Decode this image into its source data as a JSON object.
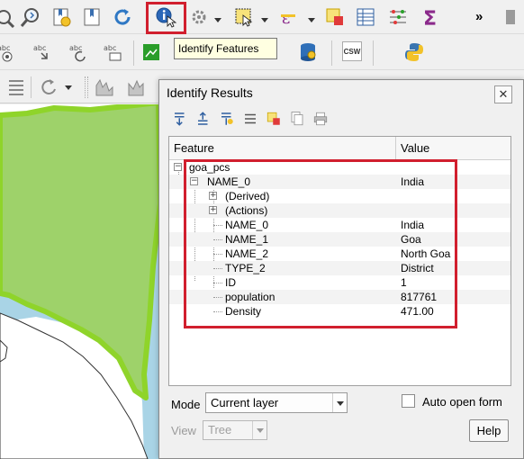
{
  "tooltip": {
    "text": "Identify Features"
  },
  "toolbar": {
    "row1": [
      "pan-map-icon",
      "zoom-in-icon",
      "new-bookmark-icon",
      "show-bookmarks-icon",
      "refresh-icon",
      "identify-features-icon",
      "measure-icon",
      "select-features-icon",
      "select-expression-icon",
      "deselect-icon",
      "attribute-table-icon",
      "field-calculator-icon",
      "statistics-icon",
      "overflow-chevron-icon"
    ],
    "row2": [
      "label-tool-icon",
      "move-label-icon",
      "rotate-label-icon",
      "change-label-icon",
      "raster-import-icon",
      "database-icon",
      "csw-icon",
      "python-icon"
    ],
    "csw_label": "CSW",
    "overflow_label": "»"
  },
  "identify_results": {
    "title": "Identify Results",
    "close_label": "✕",
    "columns": {
      "feature": "Feature",
      "value": "Value"
    },
    "layer": "goa_pcs",
    "feature_node": {
      "label": "NAME_0",
      "value": "India"
    },
    "groups": [
      "(Derived)",
      "(Actions)"
    ],
    "attributes": [
      {
        "name": "NAME_0",
        "value": "India"
      },
      {
        "name": "NAME_1",
        "value": "Goa"
      },
      {
        "name": "NAME_2",
        "value": "North Goa"
      },
      {
        "name": "TYPE_2",
        "value": "District"
      },
      {
        "name": "ID",
        "value": "1"
      },
      {
        "name": "population",
        "value": "817761"
      },
      {
        "name": "Density",
        "value": "471.00"
      }
    ],
    "mode_label": "Mode",
    "mode_value": "Current layer",
    "auto_open_label": "Auto open form",
    "auto_open_checked": false,
    "view_label": "View",
    "view_value": "Tree",
    "help_label": "Help"
  },
  "colors": {
    "highlight_red": "#d11f2e",
    "map_land": "#9ed26a",
    "map_border": "#8fd42a",
    "map_sea": "#b3d5e6"
  }
}
